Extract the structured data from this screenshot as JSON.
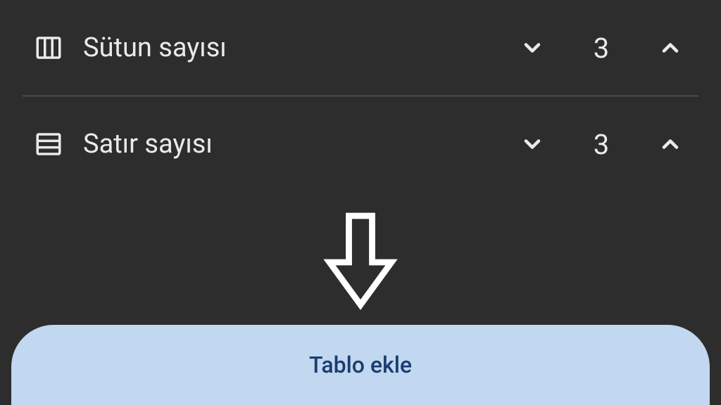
{
  "columns": {
    "label": "Sütun sayısı",
    "value": "3"
  },
  "rows": {
    "label": "Satır sayısı",
    "value": "3"
  },
  "action": {
    "add_table_label": "Tablo ekle"
  },
  "colors": {
    "background": "#2d2d2d",
    "text": "#e8eaed",
    "button_bg": "#c2d7f0",
    "button_text": "#1a3e6e",
    "divider": "#5f6368"
  }
}
